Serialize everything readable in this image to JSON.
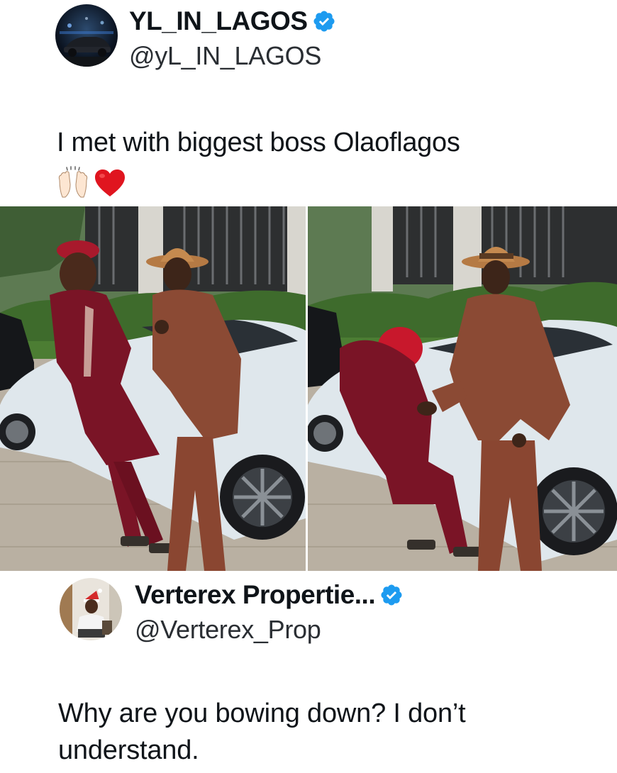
{
  "tweet": {
    "author": {
      "display_name": "YL_IN_LAGOS",
      "handle": "@yL_IN_LAGOS",
      "verified": true,
      "avatar_icon": "avatar-car-night"
    },
    "text": "I met with biggest boss Olaoflagos",
    "emojis": [
      "raising-hands-emoji",
      "red-heart-emoji"
    ],
    "media": [
      {
        "name": "photo-two-men-posing-by-car"
      },
      {
        "name": "photo-man-bowing-handshake-by-car"
      }
    ]
  },
  "reply": {
    "author": {
      "display_name": "Verterex Propertie...",
      "handle": "@Verterex_Prop",
      "verified": true,
      "avatar_icon": "avatar-person-santa-hat"
    },
    "text": "Why are you bowing down? I don’t understand."
  },
  "colors": {
    "verified_blue": "#1d9bf0",
    "text_primary": "#0f1419",
    "heart_red": "#e0151f"
  }
}
